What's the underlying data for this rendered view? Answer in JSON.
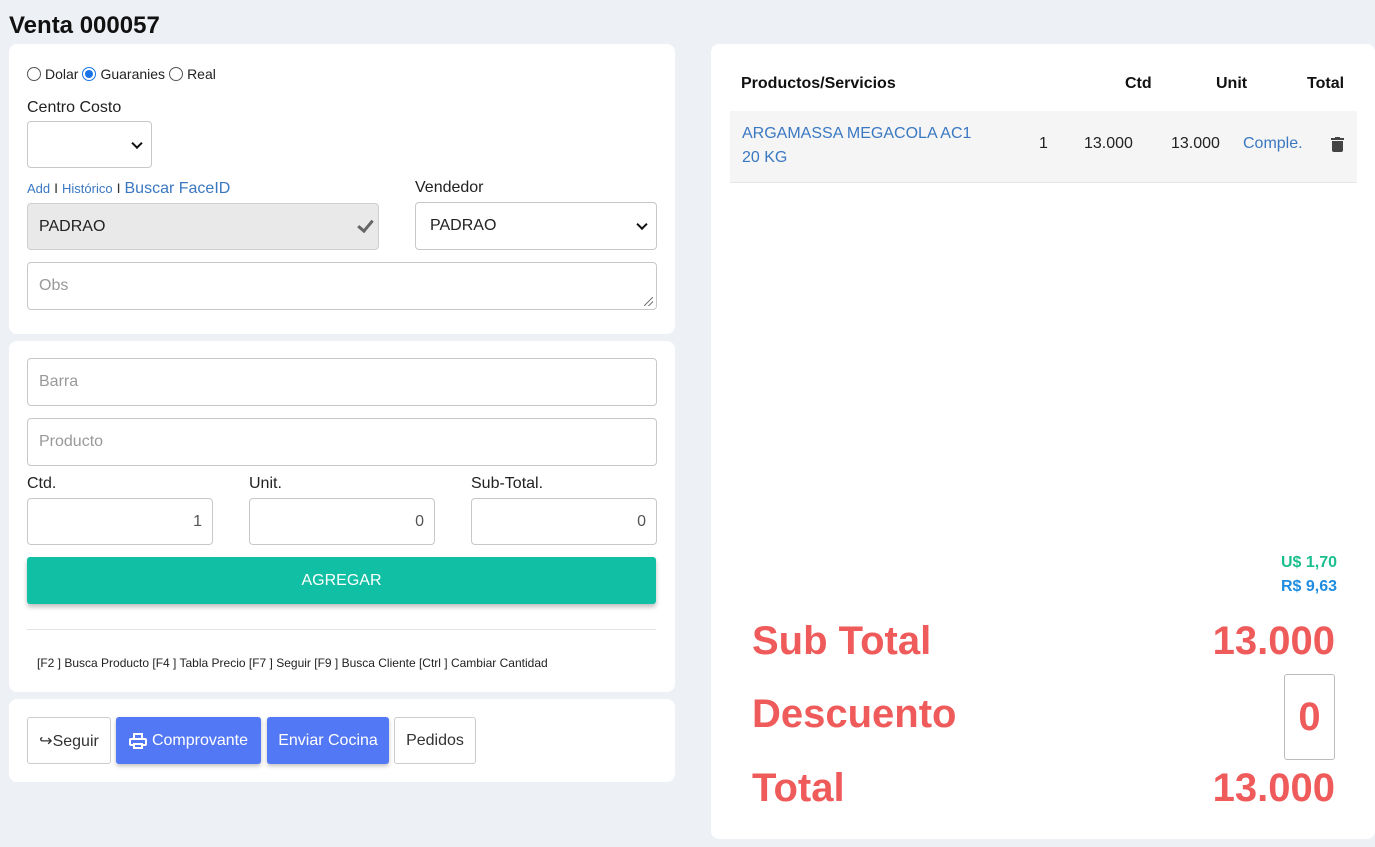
{
  "page": {
    "title": "Venta 000057"
  },
  "currency": {
    "options": [
      {
        "label": "Dolar",
        "checked": false
      },
      {
        "label": "Guaranies",
        "checked": true
      },
      {
        "label": "Real",
        "checked": false
      }
    ]
  },
  "centro_costo": {
    "label": "Centro Costo",
    "value": ""
  },
  "client_links": {
    "add": "Add",
    "historico": "Histórico",
    "buscar_face": "Buscar FaceID",
    "separator": "I"
  },
  "client": {
    "value": "PADRAO"
  },
  "vendedor": {
    "label": "Vendedor",
    "value": "PADRAO"
  },
  "obs": {
    "placeholder": "Obs"
  },
  "entry": {
    "barra_placeholder": "Barra",
    "producto_placeholder": "Producto",
    "ctd_label": "Ctd.",
    "ctd_value": "1",
    "unit_label": "Unit.",
    "unit_value": "0",
    "subtotal_label": "Sub-Total.",
    "subtotal_value": "0",
    "agregar": "AGREGAR",
    "shortcuts": "[F2 ] Busca Producto [F4 ] Tabla Precio [F7 ] Seguir [F9 ] Busca Cliente [Ctrl ] Cambiar Cantidad"
  },
  "actions": {
    "seguir": "↪Seguir",
    "comprovante": "Comprovante",
    "enviar_cocina": "Enviar Cocina",
    "pedidos": "Pedidos"
  },
  "cart": {
    "headers": {
      "product": "Productos/Servicios",
      "ctd": "Ctd",
      "unit": "Unit",
      "total": "Total"
    },
    "items": [
      {
        "name": "ARGAMASSA MEGACOLA AC1 20 KG",
        "ctd": "1",
        "unit": "13.000",
        "total": "13.000",
        "action": "Comple."
      }
    ]
  },
  "totals": {
    "usd": "U$ 1,70",
    "brl": "R$ 9,63",
    "subtotal_label": "Sub Total",
    "subtotal_value": "13.000",
    "descuento_label": "Descuento",
    "descuento_value": "0",
    "total_label": "Total",
    "total_value": "13.000"
  },
  "colors": {
    "accent_teal": "#11bfa4",
    "accent_blue": "#5378f6",
    "totals_red": "#ef5a5a",
    "usd_green": "#1bbf8e",
    "brl_blue": "#1f8de0",
    "link_blue": "#3a78c2"
  }
}
